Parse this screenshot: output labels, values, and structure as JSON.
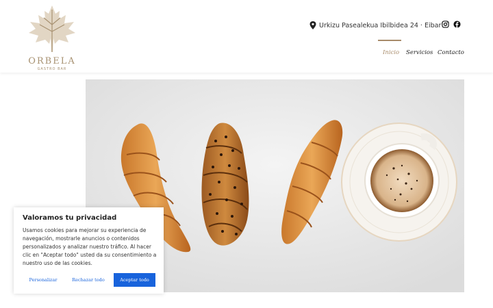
{
  "brand": {
    "name": "ORBELA",
    "tagline": "GASTRO BAR",
    "color": "#a89272"
  },
  "header": {
    "address": "Urkizu Pasealekua Ibilbidea 24 · Eibar",
    "social": [
      "instagram-icon",
      "facebook-icon"
    ],
    "nav": [
      {
        "label": "Inicio",
        "active": true
      },
      {
        "label": "Servicios",
        "active": false
      },
      {
        "label": "Contacto",
        "active": false
      }
    ],
    "accent": "#a88b6a"
  },
  "hero": {
    "image": "croissants-and-coffee-photo"
  },
  "cookie_banner": {
    "title": "Valoramos tu privacidad",
    "text": "Usamos cookies para mejorar su experiencia de navegación, mostrarle anuncios o contenidos personalizados y analizar nuestro tráfico. Al hacer clic en \"Aceptar todo\" usted da su consentimiento a nuestro uso de las cookies.",
    "customize_label": "Personalizar",
    "reject_label": "Rechazar todo",
    "accept_label": "Aceptar todo",
    "button_color": "#1863dc"
  }
}
